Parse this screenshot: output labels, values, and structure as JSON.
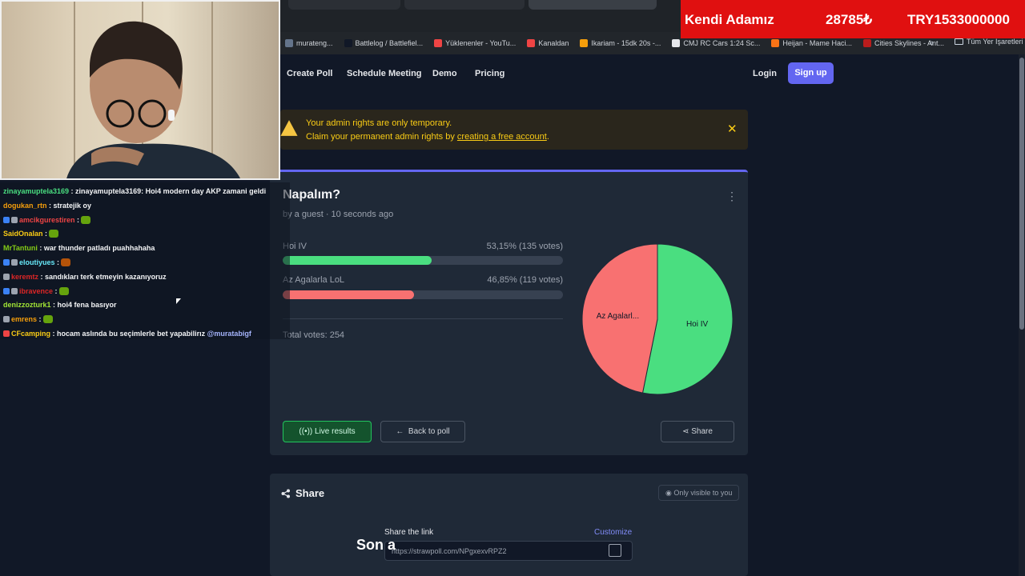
{
  "ticker": {
    "name": "Kendi Adamız",
    "price": "28785₺",
    "cap": "TRY1533000000"
  },
  "bookmarks": [
    {
      "label": "murateng...",
      "color": "#64748b"
    },
    {
      "label": "Battlelog / Battlefiel...",
      "color": "#111827"
    },
    {
      "label": "Yüklenenler - YouTu...",
      "color": "#ef4444"
    },
    {
      "label": "Kanaldan",
      "color": "#ef4444"
    },
    {
      "label": "Ikariam - 15dk 20s -...",
      "color": "#f59e0b"
    },
    {
      "label": "CMJ RC Cars 1:24 Sc...",
      "color": "#e5e7eb"
    },
    {
      "label": "Heijan - Mame Haci...",
      "color": "#f97316"
    },
    {
      "label": "Cities Skylines - Ant...",
      "color": "#b91c1c"
    }
  ],
  "bookmark_more": "»",
  "bookmark_folder": "Tüm Yer İşaretleri",
  "nav": {
    "create_poll": "Create Poll",
    "schedule": "Schedule Meeting",
    "demo": "Demo",
    "pricing": "Pricing",
    "login": "Login",
    "signup": "Sign up"
  },
  "alert": {
    "line1": "Your admin rights are only temporary.",
    "line2_prefix": "Claim your permanent admin rights by ",
    "link": "creating a free account",
    "line2_suffix": ".",
    "close": "✕"
  },
  "poll": {
    "title": "Napalım?",
    "meta": "by a guest · 10 seconds ago",
    "options": [
      {
        "label": "Hoi IV",
        "pct_text": "53,15% (135 votes)",
        "fraction": 0.5315,
        "color": "#4ade80"
      },
      {
        "label": "Az Agalarla LoL",
        "pct_text": "46,85% (119 votes)",
        "fraction": 0.4685,
        "color": "#f87171"
      }
    ],
    "total": "Total votes: 254",
    "pie_labels": [
      "Hoi IV",
      "Az Agalarl..."
    ],
    "buttons": {
      "live": "Live results",
      "back": "Back to poll",
      "share": "Share"
    }
  },
  "share": {
    "title": "Share",
    "visibility": "Only visible to you",
    "link_label": "Share the link",
    "customize": "Customize",
    "url": "https://strawpoll.com/NPgxexvRPZ2"
  },
  "subtitle": "Son a",
  "chat": [
    {
      "user": "zinayamuptela3169",
      "user_color": "#4ade80",
      "msg": " : zinayamuptela3169: Hoi4 modern day AKP zamani geldi",
      "badges": [],
      "emote": null
    },
    {
      "user": "dogukan_rtn",
      "user_color": "#f59e0b",
      "msg": " : stratejik oy",
      "badges": [],
      "emote": null
    },
    {
      "user": "amcikgurestiren",
      "user_color": "#ef4444",
      "msg": " :",
      "badges": [
        "#3b82f6",
        "#9ca3af"
      ],
      "emote": "#65a30d"
    },
    {
      "user": "SaidOnalan",
      "user_color": "#facc15",
      "msg": " :",
      "badges": [],
      "emote": "#65a30d"
    },
    {
      "user": "MrTantuni",
      "user_color": "#84cc16",
      "msg": " : war thunder patladı puahhahaha",
      "badges": [],
      "emote": null
    },
    {
      "user": "eloutiyues",
      "user_color": "#67e8f9",
      "msg": " :",
      "badges": [
        "#3b82f6",
        "#9ca3af"
      ],
      "emote": "#b45309"
    },
    {
      "user": "keremtz",
      "user_color": "#dc2626",
      "msg": " : sandıkları terk etmeyin kazanıyoruz",
      "badges": [
        "#9ca3af"
      ],
      "emote": null
    },
    {
      "user": "ibravence",
      "user_color": "#dc2626",
      "msg": " :",
      "badges": [
        "#3b82f6",
        "#9ca3af"
      ],
      "emote": "#65a30d"
    },
    {
      "user": "denizzozturk1",
      "user_color": "#a3e635",
      "msg": " : hoi4 fena basıyor",
      "badges": [],
      "emote": null
    },
    {
      "user": "emrens",
      "user_color": "#f59e0b",
      "msg": " :",
      "badges": [
        "#9ca3af"
      ],
      "emote": "#65a30d"
    },
    {
      "user": "CFcamping",
      "user_color": "#facc15",
      "msg": " : hocam aslında bu seçimlerle bet yapabilirız ",
      "mention": "@muratabigf",
      "badges": [
        "#ef4444"
      ],
      "emote": null
    }
  ]
}
